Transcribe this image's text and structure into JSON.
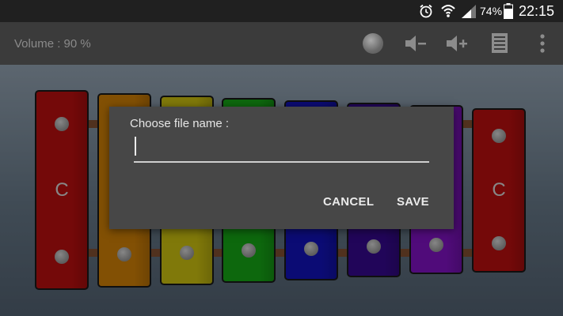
{
  "status_bar": {
    "battery_percent": "74%",
    "time": "22:15",
    "icons": [
      "alarm-icon",
      "wifi-icon",
      "signal-icon",
      "battery-icon"
    ]
  },
  "toolbar": {
    "volume_label": "Volume : 90 %",
    "icons": [
      "record-icon",
      "volume-down-icon",
      "volume-up-icon",
      "list-icon",
      "overflow-menu-icon"
    ]
  },
  "xylophone": {
    "bars": [
      {
        "note": "C",
        "color": "#c81010"
      },
      {
        "note": "",
        "color": "#e08a08"
      },
      {
        "note": "",
        "color": "#dcd012"
      },
      {
        "note": "",
        "color": "#18b418"
      },
      {
        "note": "",
        "color": "#1414c8"
      },
      {
        "note": "",
        "color": "#3a0a9a"
      },
      {
        "note": "",
        "color": "#8a14d2"
      },
      {
        "note": "C",
        "color": "#c81010"
      }
    ]
  },
  "dialog": {
    "title": "Choose file name :",
    "input_value": "",
    "cancel_label": "CANCEL",
    "save_label": "SAVE"
  },
  "colors": {
    "toolbar_bg": "#3b3b3b",
    "dialog_bg": "#474747",
    "statusbar_bg": "#202020"
  }
}
